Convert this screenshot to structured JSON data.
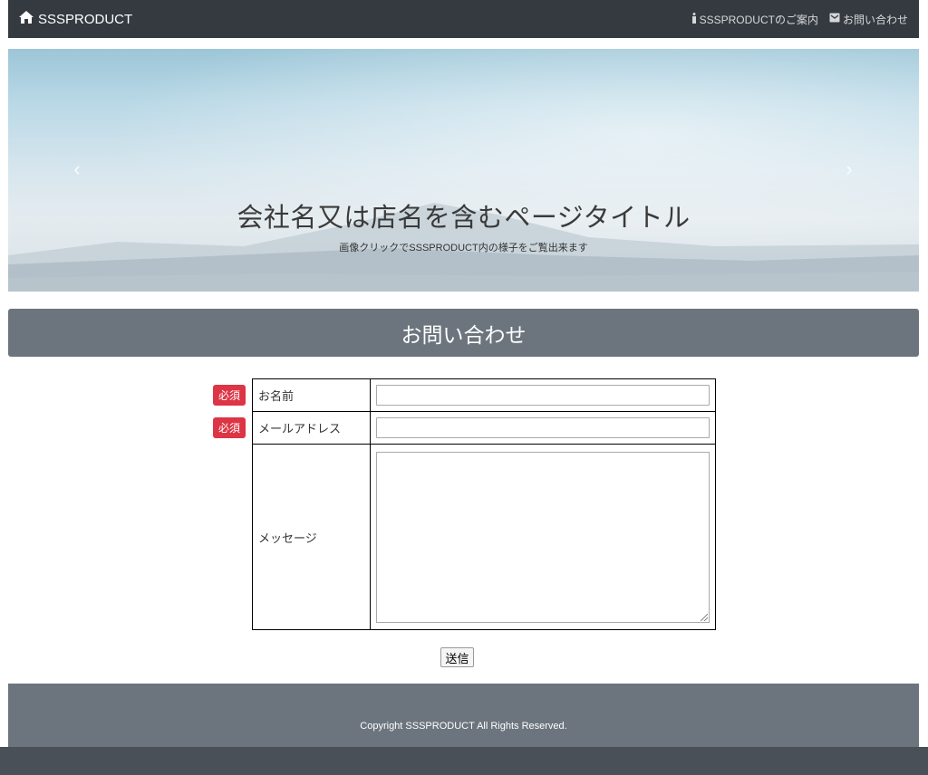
{
  "navbar": {
    "brand": "SSSPRODUCT",
    "links": [
      {
        "icon": "info-icon",
        "label": "SSSPRODUCTのご案内"
      },
      {
        "icon": "envelope-icon",
        "label": "お問い合わせ"
      }
    ]
  },
  "hero": {
    "title": "会社名又は店名を含むページタイトル",
    "subtitle": "画像クリックでSSSPRODUCT内の様子をご覧出来ます",
    "prev_icon": "chevron-left-icon",
    "next_icon": "chevron-right-icon"
  },
  "section": {
    "title": "お問い合わせ"
  },
  "form": {
    "required_label": "必須",
    "fields": [
      {
        "label": "お名前",
        "value": "",
        "required": true
      },
      {
        "label": "メールアドレス",
        "value": "",
        "required": true
      },
      {
        "label": "メッセージ",
        "value": "",
        "required": false
      }
    ],
    "submit_label": "送信"
  },
  "footer": {
    "copyright": "Copyright SSSPRODUCT All Rights Reserved."
  },
  "colors": {
    "navbar": "#343a40",
    "heading_bar": "#6c757d",
    "required_badge": "#dc3545",
    "footer": "#6c757d",
    "footer_bottom": "#495057"
  }
}
